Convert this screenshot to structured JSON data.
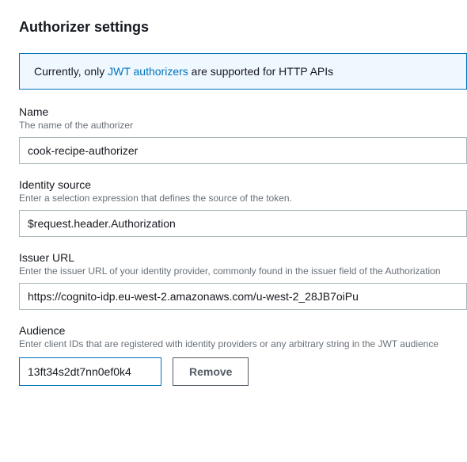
{
  "page_title": "Authorizer settings",
  "info_alert": {
    "prefix": "Currently, only ",
    "link_text": "JWT authorizers",
    "suffix": " are supported for HTTP APIs"
  },
  "fields": {
    "name": {
      "label": "Name",
      "description": "The name of the authorizer",
      "value": "cook-recipe-authorizer"
    },
    "identity_source": {
      "label": "Identity source",
      "description": "Enter a selection expression that defines the source of the token.",
      "value": "$request.header.Authorization"
    },
    "issuer_url": {
      "label": "Issuer URL",
      "description": "Enter the issuer URL of your identity provider, commonly found in the issuer field of the Authorization",
      "value": "https://cognito-idp.eu-west-2.amazonaws.com/u-west-2_28JB7oiPu"
    },
    "audience": {
      "label": "Audience",
      "description": "Enter client IDs that are registered with identity providers or any arbitrary string in the JWT audience",
      "value": "13ft34s2dt7nn0ef0k4",
      "remove_label": "Remove"
    }
  }
}
